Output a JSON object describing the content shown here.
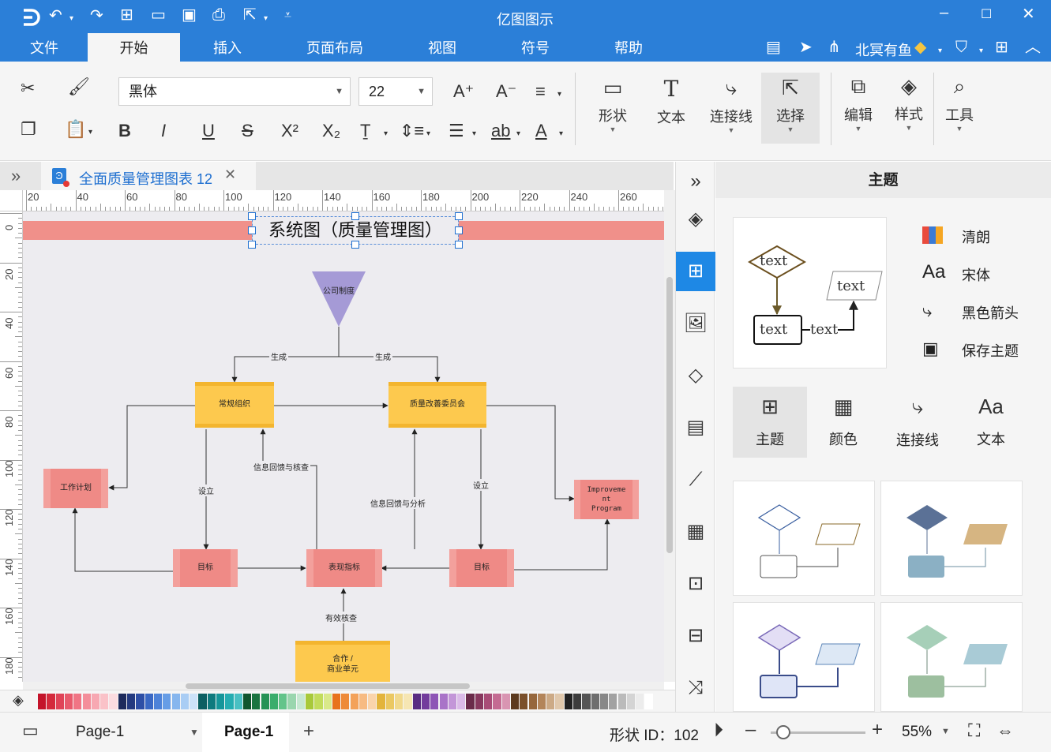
{
  "app": {
    "title": "亿图图示",
    "menus": [
      "文件",
      "开始",
      "插入",
      "页面布局",
      "视图",
      "符号",
      "帮助"
    ],
    "active_menu": "开始",
    "user_name": "北冥有鱼"
  },
  "ribbon": {
    "font_name": "黑体",
    "font_size": "22",
    "big_buttons": [
      "形状",
      "文本",
      "连接线",
      "选择",
      "编辑",
      "样式",
      "工具"
    ]
  },
  "document": {
    "tab_title": "全面质量管理图表 12"
  },
  "ruler": {
    "h_ticks": [
      "20",
      "40",
      "60",
      "80",
      "100",
      "120",
      "140",
      "160",
      "180",
      "200",
      "220",
      "240",
      "260"
    ],
    "v_ticks": [
      "0",
      "20",
      "40",
      "60",
      "80",
      "100",
      "120",
      "140",
      "160",
      "180"
    ]
  },
  "diagram": {
    "title": "系统图（质量管理图）",
    "nodes": {
      "company": "公司制度",
      "regular_org": "常规组织",
      "quality_committee": "质量改善委员会",
      "work_plan": "工作计划",
      "improvement": "Improveme\nnt\nProgram",
      "goal_left": "目标",
      "perf_index": "表现指标",
      "goal_right": "目标",
      "partner": "合作 /\n商业单元"
    },
    "edges": {
      "gen_left": "生成",
      "gen_right": "生成",
      "setup_left": "设立",
      "setup_right": "设立",
      "feedback_check": "信息回馈与核查",
      "feedback_analysis": "信息回馈与分析",
      "valid_check": "有效核查"
    }
  },
  "panel": {
    "header": "主题",
    "preview_text": "text",
    "options": [
      "清朗",
      "宋体",
      "黑色箭头",
      "保存主题"
    ],
    "tabs": [
      "主题",
      "颜色",
      "连接线",
      "文本"
    ],
    "active_tab": "主题"
  },
  "status": {
    "page_select": "Page-1",
    "page_tab": "Page-1",
    "shape_id": "形状 ID：102",
    "zoom": "55%"
  },
  "colors": {
    "brand": "#2b7fd8",
    "title_band": "#f0908a",
    "yellow_node": "#fdc94e",
    "pink_node": "#ef8a86",
    "triangle": "#a59ad6",
    "active_side": "#1e88e5"
  }
}
